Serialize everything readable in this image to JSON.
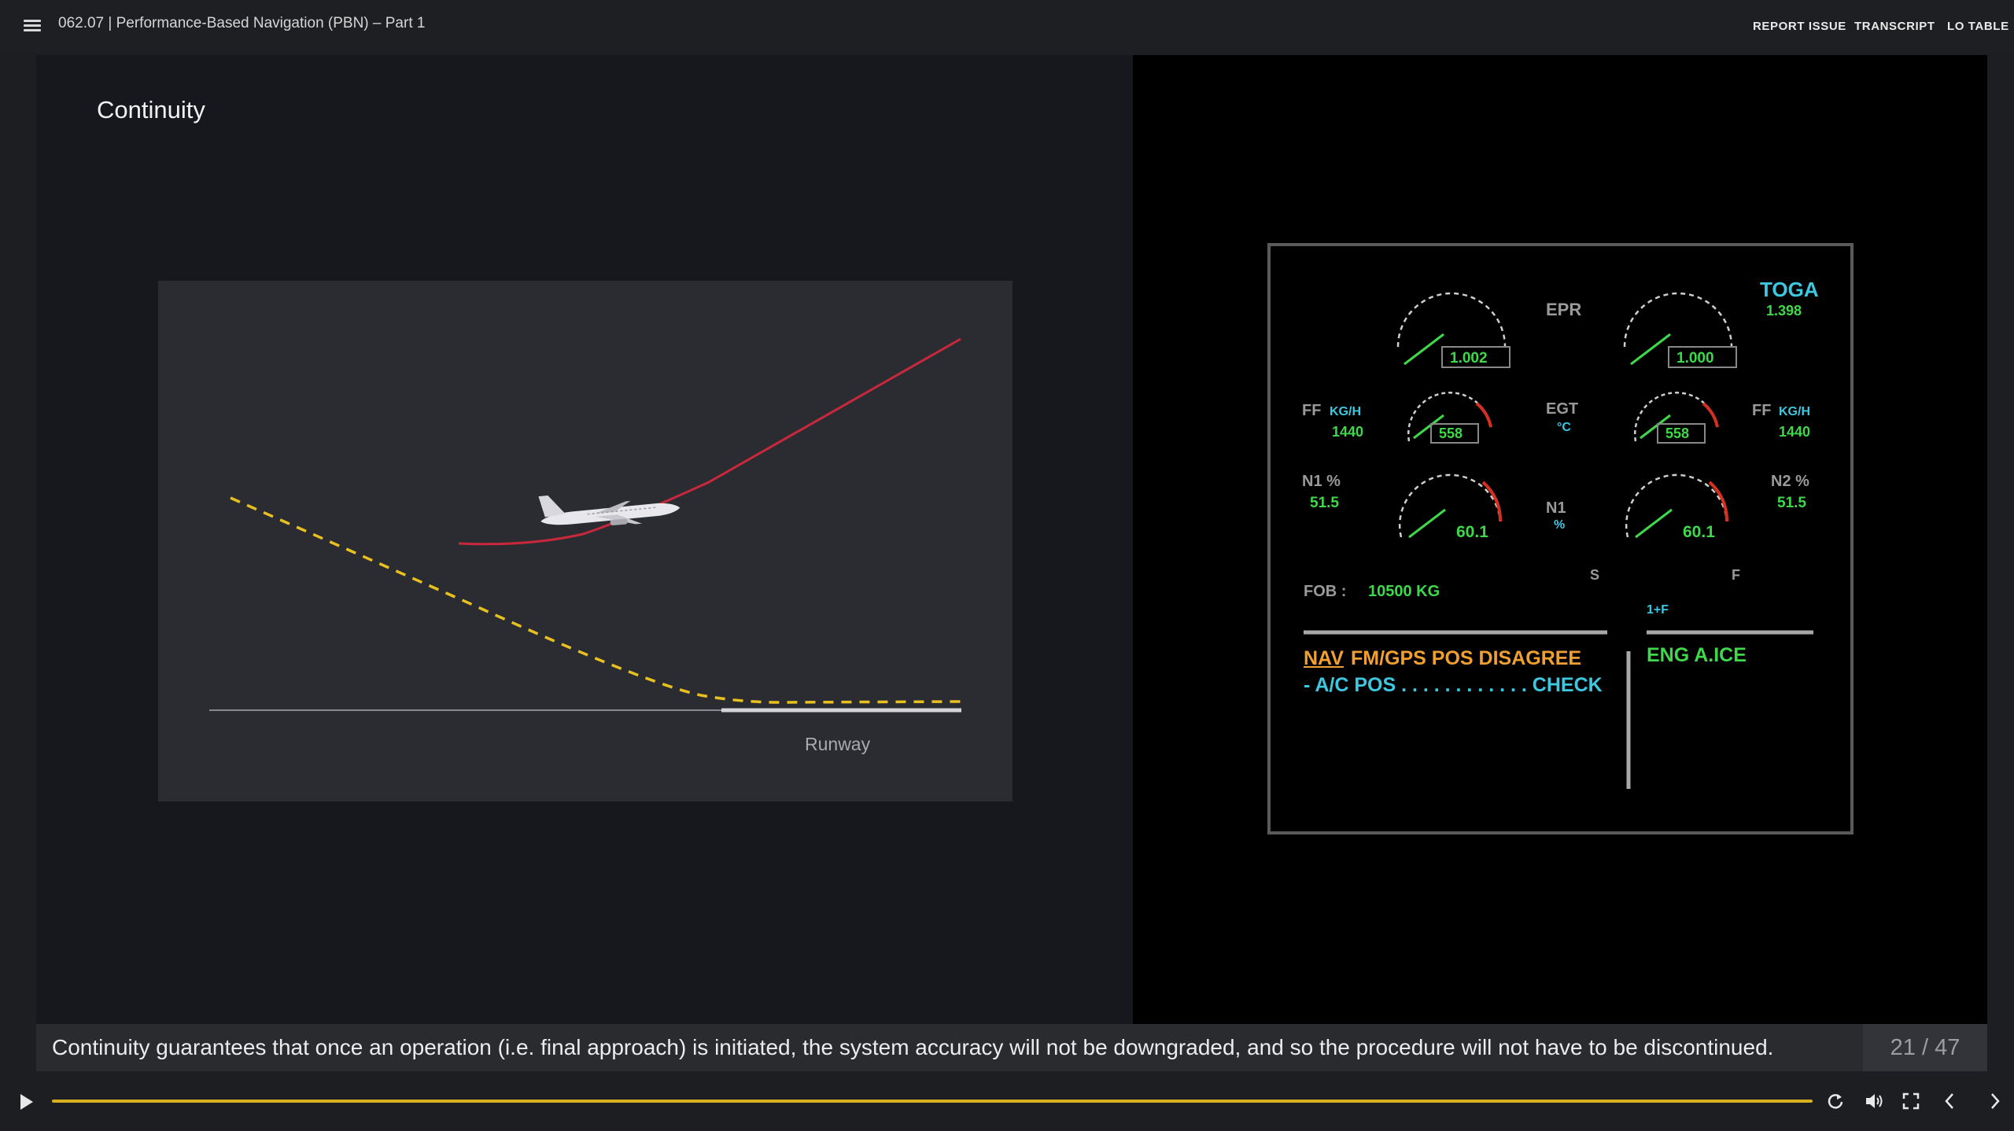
{
  "header": {
    "course_title": "062.07 | Performance-Based Navigation (PBN) – Part 1",
    "links": [
      "REPORT ISSUE",
      "TRANSCRIPT",
      "LO TABLE"
    ]
  },
  "slide": {
    "title": "Continuity",
    "diagram": {
      "runway_label": "Runway"
    }
  },
  "ecam": {
    "epr_label": "EPR",
    "toga_label": "TOGA",
    "toga_value": "1.398",
    "epr_left_value": "1.002",
    "epr_right_value": "1.000",
    "ff_label_left": "FF",
    "ff_unit_left": "KG/H",
    "ff_value_left": "1440",
    "ff_label_right": "FF",
    "ff_unit_right": "KG/H",
    "ff_value_right": "1440",
    "egt_label": "EGT",
    "egt_unit": "°C",
    "egt_left_value": "558",
    "egt_right_value": "558",
    "n1_label": "N1 %",
    "n1_value": "51.5",
    "n2_label": "N2 %",
    "n2_value": "51.5",
    "n1_center_label": "N1",
    "n1_center_unit": "%",
    "n1_left_value": "60.1",
    "n1_right_value": "60.1",
    "fob_label": "FOB :",
    "fob_value": "10500 KG",
    "flap_s": "S",
    "flap_f": "F",
    "flap_pos": "1+F",
    "nav_prefix": "NAV",
    "nav_message": "FM/GPS POS DISAGREE",
    "action_line": "- A/C POS . . . . . . . . . . . . CHECK",
    "memo": "ENG A.ICE",
    "colors": {
      "amber": "#f0a030",
      "cyan": "#3ec8e0",
      "green": "#3fd84a",
      "white": "#e8e8e8"
    }
  },
  "caption": {
    "text": "Continuity guarantees that once an operation (i.e. final approach) is initiated, the system accuracy will not be downgraded, and so the procedure will not have to be discontinued.",
    "page_counter": "21 / 47"
  },
  "player": {
    "progress": 1.0,
    "icons": [
      "play-icon",
      "replay-icon",
      "volume-icon",
      "fullscreen-icon",
      "prev-icon",
      "next-icon"
    ]
  }
}
